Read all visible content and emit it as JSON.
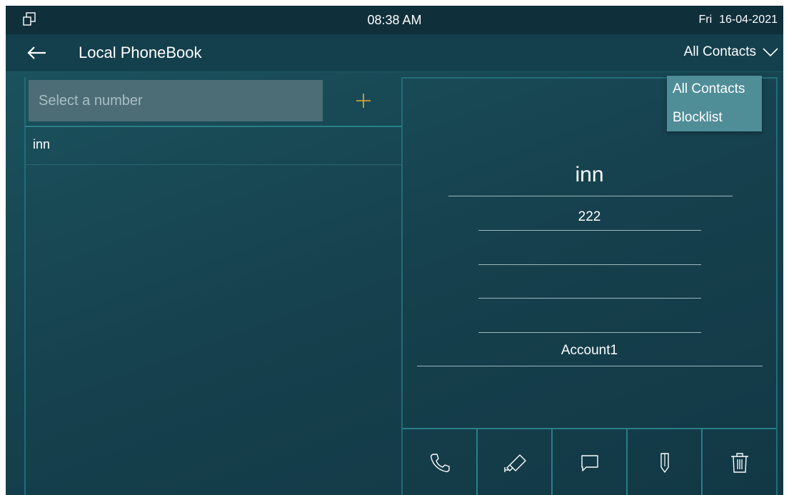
{
  "status": {
    "icon": "multi-window-icon",
    "time": "08:38 AM",
    "day": "Fri",
    "date": "16-04-2021"
  },
  "header": {
    "title": "Local PhoneBook",
    "filter_label": "All Contacts",
    "back_icon": "back-arrow-icon",
    "filter_icon": "chevron-down-icon"
  },
  "search": {
    "placeholder": "Select a number",
    "add_icon": "plus-icon"
  },
  "contacts": [
    {
      "name": "inn"
    }
  ],
  "detail": {
    "name": "inn",
    "number": "222",
    "field3": "",
    "field4": "",
    "field5": "",
    "account": "Account1"
  },
  "actions": [
    {
      "icon": "phone-icon"
    },
    {
      "icon": "video-camera-icon"
    },
    {
      "icon": "message-icon"
    },
    {
      "icon": "edit-pencil-icon"
    },
    {
      "icon": "trash-icon"
    }
  ],
  "dropdown": {
    "items": [
      "All Contacts",
      "Blocklist"
    ]
  },
  "colors": {
    "accent": "#f0a830",
    "background": "#16404d",
    "divider": "#2a7e89"
  }
}
